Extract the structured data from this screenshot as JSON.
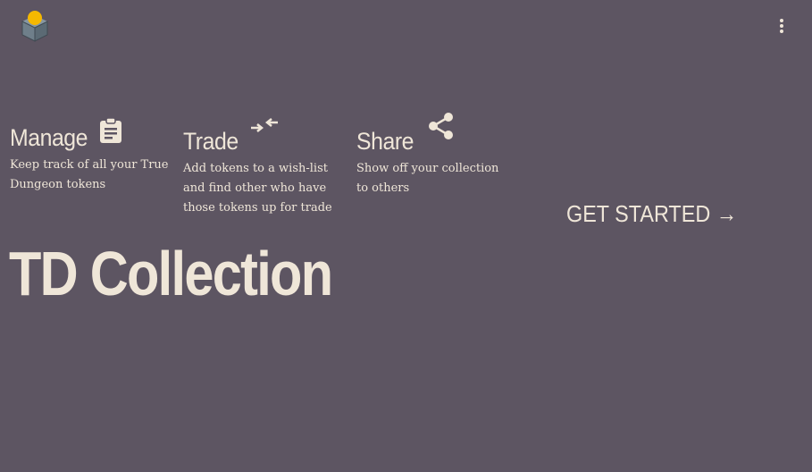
{
  "header": {
    "logo_icon": "cube-logo-icon",
    "menu_icon": "more-vertical-icon"
  },
  "features": [
    {
      "title": "Manage",
      "icon": "clipboard-icon",
      "description": "Keep track of all your True Dungeon tokens"
    },
    {
      "title": "Trade",
      "icon": "swap-arrows-icon",
      "description": "Add tokens to a wish-list and find other who have those tokens up for trade"
    },
    {
      "title": "Share",
      "icon": "share-icon",
      "description": "Show off your collection to others"
    }
  ],
  "cta": {
    "label": "GET STARTED →"
  },
  "hero": {
    "title": "TD Collection"
  },
  "colors": {
    "background": "#5d5562",
    "text": "#efe6d8",
    "logo_accent": "#f5b800",
    "logo_body": "#6b7b86"
  }
}
